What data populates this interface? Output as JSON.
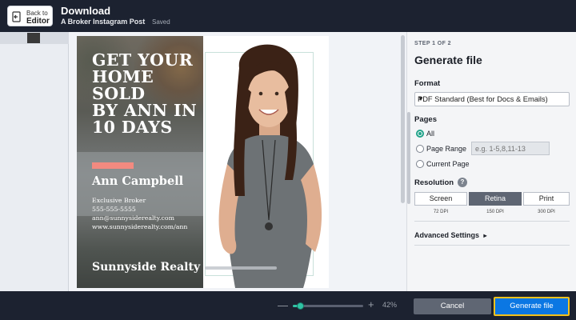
{
  "topbar": {
    "back_line1": "Back to",
    "back_line2": "Editor",
    "title": "Download",
    "subtitle": "A Broker Instagram Post",
    "saved": "Saved"
  },
  "flyer": {
    "headline_lines": [
      "GET YOUR",
      "HOME",
      "SOLD",
      "BY ANN IN",
      "10 DAYS"
    ],
    "agent_name": "Ann Campbell",
    "agent_title": "Exclusive Broker",
    "phone": "555-555-5555",
    "email": "ann@sunnysiderealty.com",
    "website": "www.sunnysiderealty.com/ann",
    "brand": "Sunnyside Realty",
    "accent_color": "#f28a80"
  },
  "zoom": {
    "value_label": "42%",
    "level": 0.1
  },
  "panel": {
    "step": "STEP 1 OF 2",
    "title": "Generate file",
    "format_label": "Format",
    "format_value": "PDF Standard (Best for Docs & Emails)",
    "pages_label": "Pages",
    "pages_options": [
      "All",
      "Page Range",
      "Current Page"
    ],
    "pages_selected": "All",
    "range_placeholder": "e.g. 1-5,8,11-13",
    "resolution_label": "Resolution",
    "help": "?",
    "resolution_options": [
      "Screen",
      "Retina",
      "Print"
    ],
    "resolution_selected": "Retina",
    "dpi": [
      "72 DPI",
      "150 DPI",
      "300 DPI"
    ],
    "advanced": "Advanced Settings",
    "advanced_caret": "▸"
  },
  "footer": {
    "cancel": "Cancel",
    "generate": "Generate file"
  },
  "colors": {
    "accent": "#2fc3a4",
    "primary": "#0b77e3",
    "focus": "#f3c21d"
  }
}
